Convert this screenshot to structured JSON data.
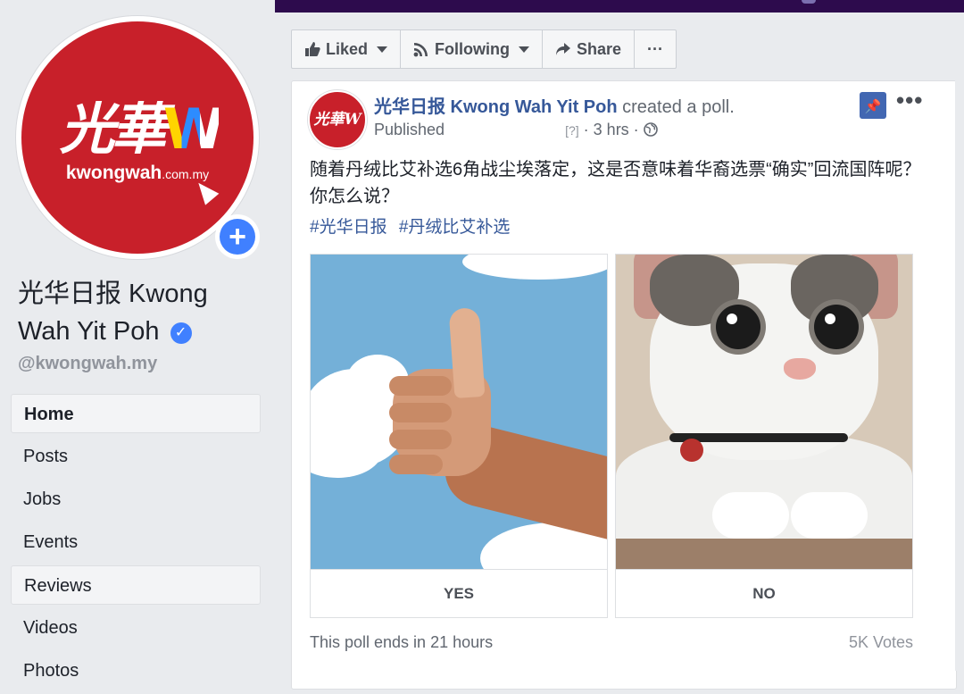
{
  "page": {
    "name": "光华日报 Kwong Wah Yit Poh",
    "handle": "@kwongwah.my",
    "avatar_logo": "光華",
    "avatar_logo_w": "W",
    "avatar_url_main": "kwongwah",
    "avatar_url_tld": ".com.my",
    "add_icon": "+",
    "verified_icon": "✓"
  },
  "nav": {
    "items": [
      {
        "label": "Home"
      },
      {
        "label": "Posts"
      },
      {
        "label": "Jobs"
      },
      {
        "label": "Events"
      },
      {
        "label": "Reviews"
      },
      {
        "label": "Videos"
      },
      {
        "label": "Photos"
      }
    ]
  },
  "actions": {
    "liked": "Liked",
    "following": "Following",
    "share": "Share",
    "more": "···"
  },
  "post": {
    "author": "光华日报 Kwong Wah Yit Poh",
    "action": "created a poll.",
    "status": "Published",
    "meta_small": "[?]",
    "time": "· 3 hrs ·",
    "body": "随着丹绒比艾补选6角战尘埃落定，这是否意味着华裔选票“确实”回流国阵呢？你怎么说？",
    "tags": [
      "#光华日报",
      "#丹绒比艾补选"
    ],
    "avatar_text": "光華W",
    "pin_icon": "📌",
    "more_icon": "•••"
  },
  "poll": {
    "options": [
      {
        "label": "YES"
      },
      {
        "label": "NO"
      }
    ],
    "ends": "This poll ends in 21 hours",
    "votes": "5K Votes"
  },
  "colors": {
    "brand_blue": "#4267b2",
    "link": "#365899",
    "logo_red": "#c8202a",
    "top_bar": "#2d0b4d"
  }
}
